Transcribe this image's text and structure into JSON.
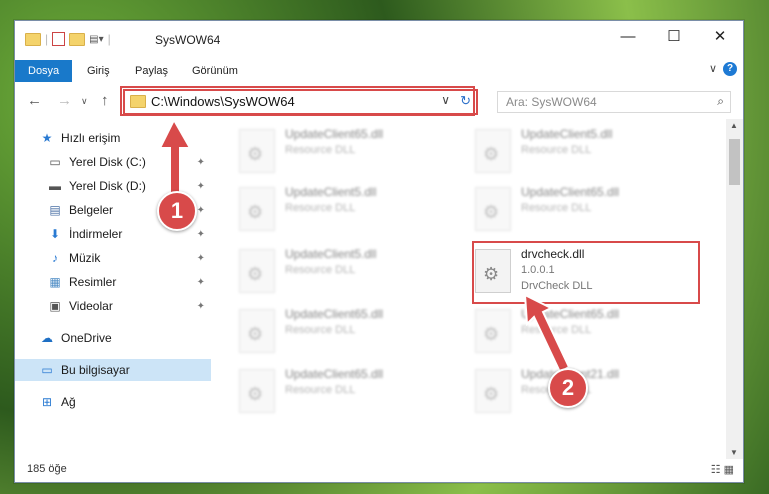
{
  "window": {
    "title": "SysWOW64"
  },
  "ribbon": {
    "tabs": [
      "Dosya",
      "Giriş",
      "Paylaş",
      "Görünüm"
    ]
  },
  "address": {
    "path": "C:\\Windows\\SysWOW64"
  },
  "search": {
    "placeholder": "Ara: SysWOW64"
  },
  "nav": {
    "items": [
      {
        "label": "Hızlı erişim",
        "icon": "star-icon"
      },
      {
        "label": "Yerel Disk (C:)",
        "icon": "drive-icon"
      },
      {
        "label": "Yerel Disk (D:)",
        "icon": "drive-icon"
      },
      {
        "label": "Belgeler",
        "icon": "documents-icon"
      },
      {
        "label": "İndirmeler",
        "icon": "download-icon"
      },
      {
        "label": "Müzik",
        "icon": "music-icon"
      },
      {
        "label": "Resimler",
        "icon": "pictures-icon"
      },
      {
        "label": "Videolar",
        "icon": "videos-icon"
      },
      {
        "label": "OneDrive",
        "icon": "cloud-icon"
      },
      {
        "label": "Bu bilgisayar",
        "icon": "computer-icon"
      },
      {
        "label": "Ağ",
        "icon": "network-icon"
      }
    ]
  },
  "files": [
    {
      "name": "UpdateClient65.dll",
      "line2": "Resource DLL",
      "line3": ""
    },
    {
      "name": "UpdateClient5.dll",
      "line2": "Resource DLL",
      "line3": ""
    },
    {
      "name": "UpdateClient5.dll",
      "line2": "Resource DLL",
      "line3": ""
    },
    {
      "name": "UpdateClient65.dll",
      "line2": "Resource DLL",
      "line3": ""
    },
    {
      "name": "UpdateClient5.dll",
      "line2": "Resource DLL",
      "line3": ""
    },
    {
      "name": "drvcheck.dll",
      "line2": "1.0.0.1",
      "line3": "DrvCheck DLL"
    },
    {
      "name": "UpdateClient65.dll",
      "line2": "Resource DLL",
      "line3": ""
    },
    {
      "name": "UpdateClient65.dll",
      "line2": "Resource DLL",
      "line3": ""
    },
    {
      "name": "UpdateClient65.dll",
      "line2": "Resource DLL",
      "line3": ""
    },
    {
      "name": "UpdateClient21.dll",
      "line2": "Resource DLL",
      "line3": ""
    }
  ],
  "status": {
    "count": "185 öğe"
  },
  "annotations": {
    "step1": "1",
    "step2": "2"
  },
  "colors": {
    "accent": "#1979ca",
    "highlight": "#d84a4a"
  }
}
